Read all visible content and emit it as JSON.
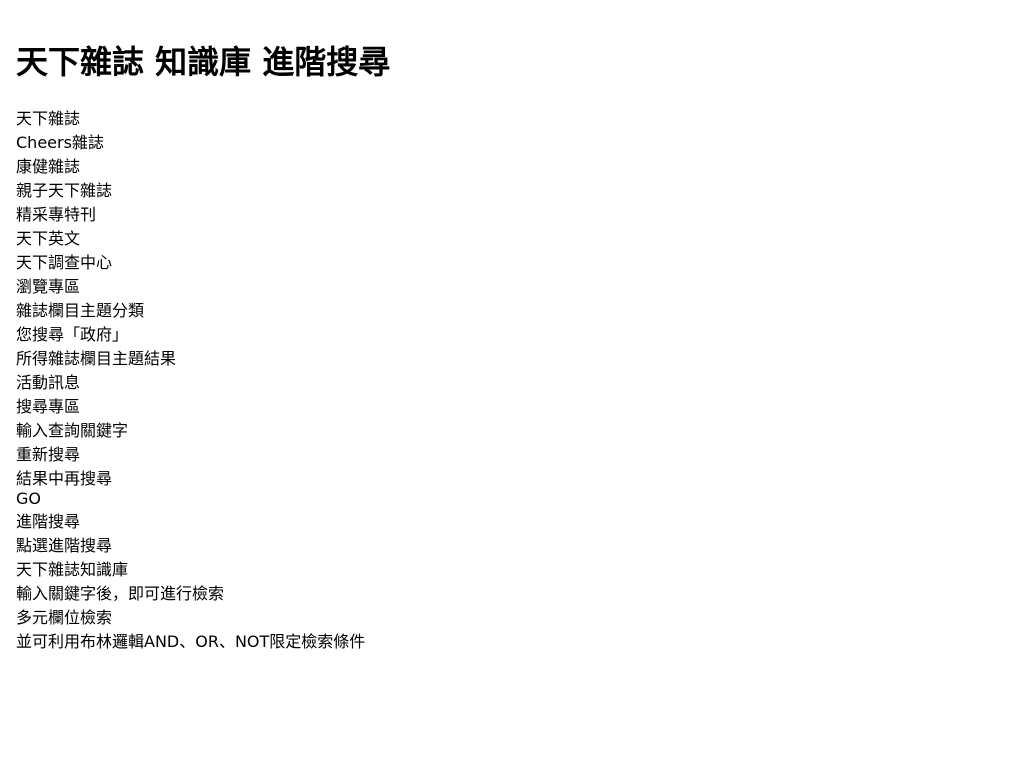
{
  "title": "天下雜誌 知識庫 進階搜尋",
  "lines": [
    "天下雜誌",
    "Cheers雜誌",
    "康健雜誌",
    "親子天下雜誌",
    "精采專特刊",
    "天下英文",
    "天下調查中心",
    "瀏覽專區",
    "雜誌欄目主題分類",
    "您搜尋「政府」",
    "所得雜誌欄目主題結果",
    "活動訊息",
    "搜尋專區",
    "輸入查詢關鍵字",
    "重新搜尋",
    "結果中再搜尋",
    "GO",
    "進階搜尋",
    "點選進階搜尋",
    "天下雜誌知識庫",
    "輸入關鍵字後，即可進行檢索",
    "多元欄位檢索",
    "並可利用布林邏輯AND、OR、NOT限定檢索條件"
  ]
}
